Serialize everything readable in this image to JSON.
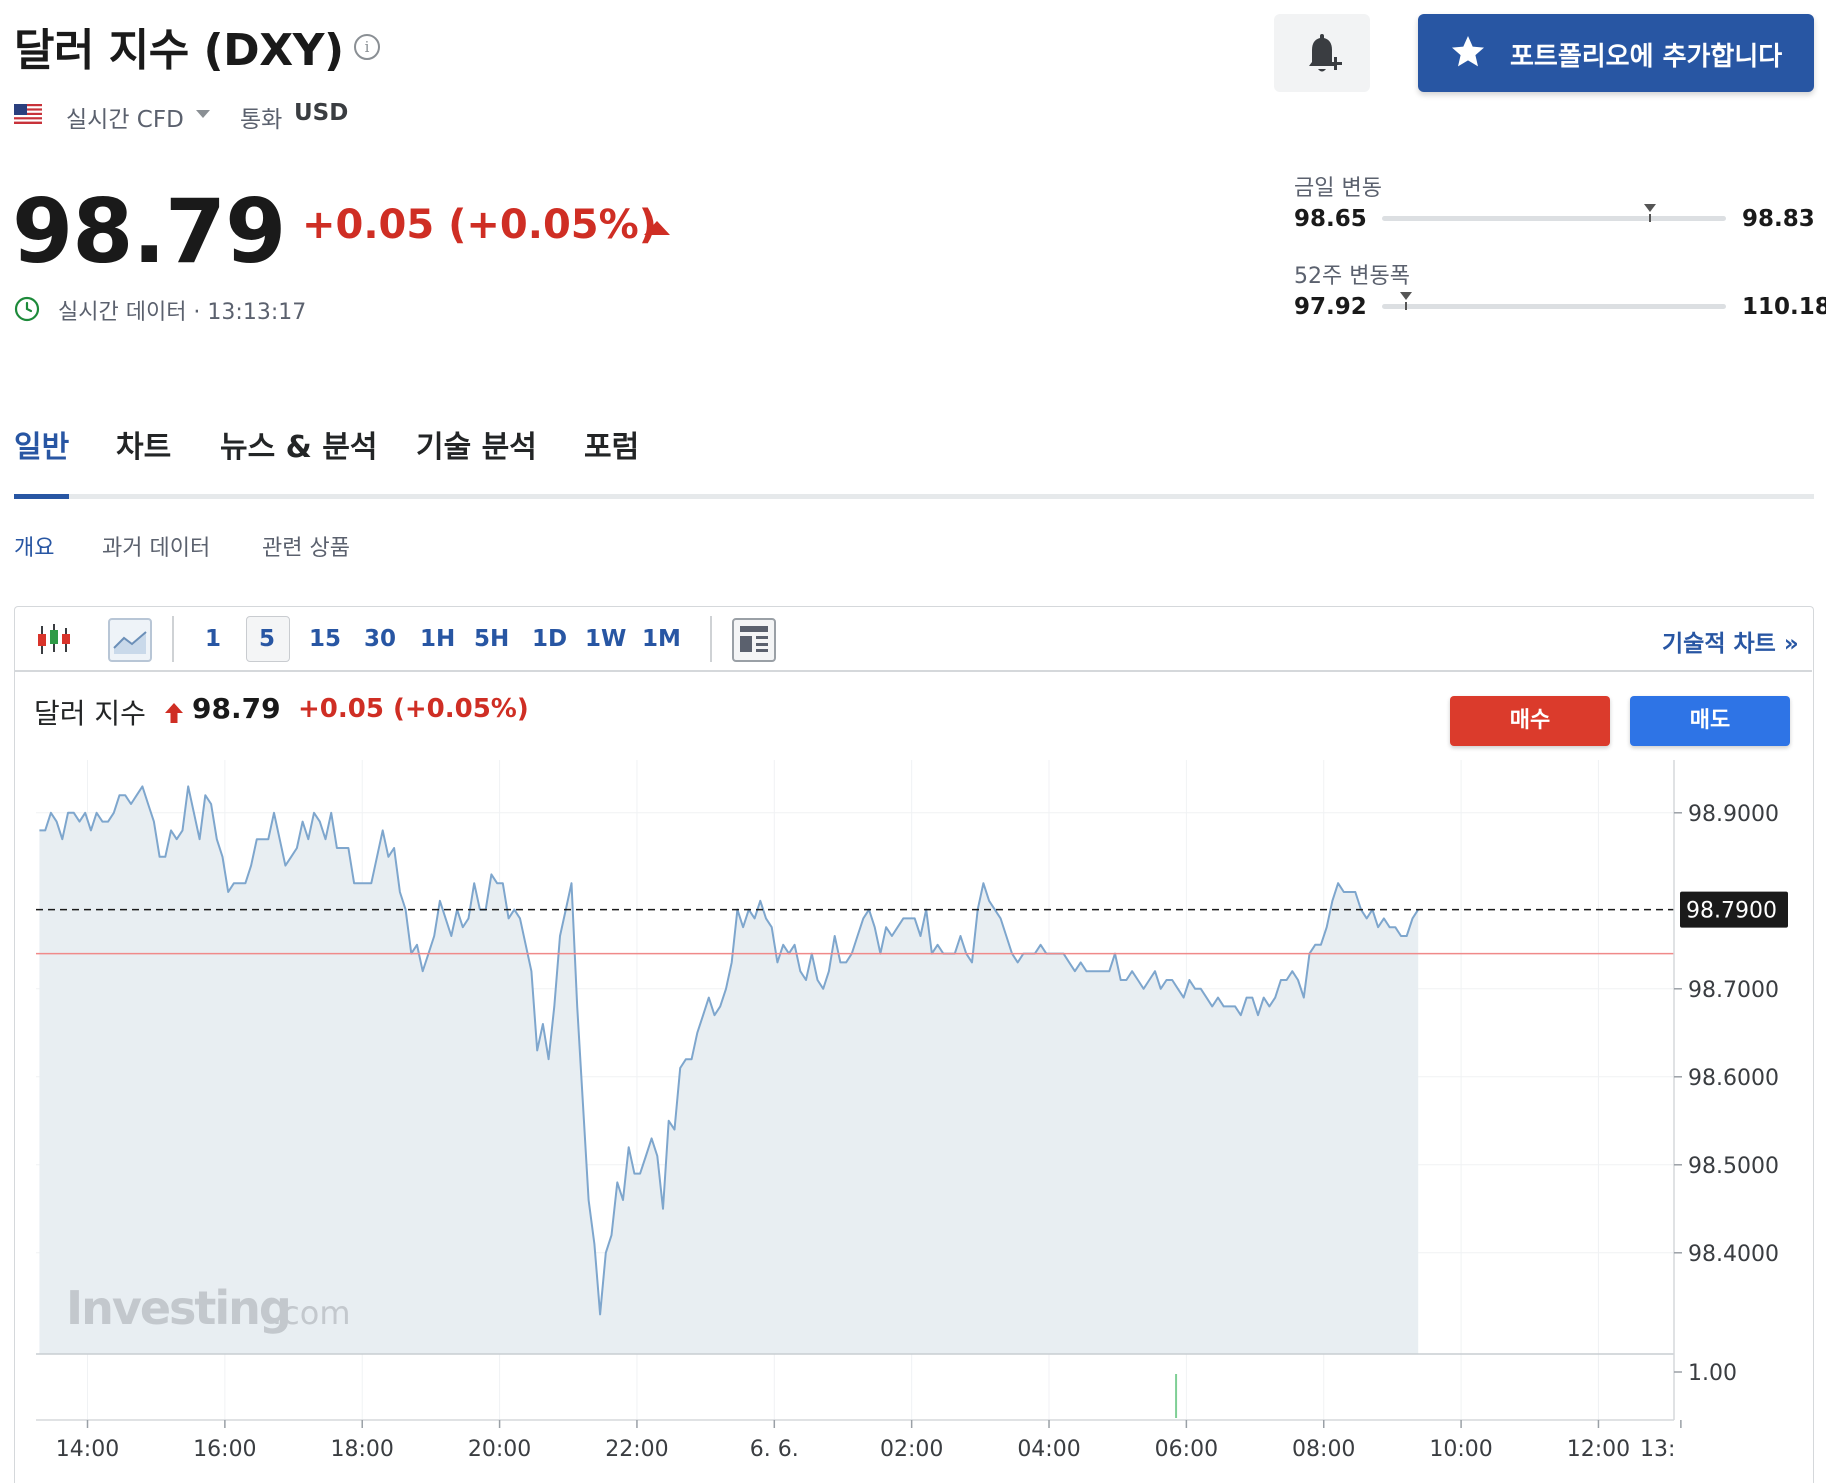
{
  "header": {
    "title": "달러 지수 (DXY)",
    "info_icon": "info-icon",
    "alert_icon": "bell-plus-icon",
    "portfolio_button": "포트폴리오에 추가합니다",
    "portfolio_icon": "star-icon",
    "market_type": "실시간 CFD",
    "currency_label": "통화",
    "currency": "USD"
  },
  "quote": {
    "price": "98.79",
    "change": "+0.05 (+0.05%)",
    "direction": "up",
    "realtime_label": "실시간 데이터 · 13:13:17"
  },
  "ranges": {
    "day": {
      "label": "금일 변동",
      "low": "98.65",
      "high": "98.83",
      "current": 98.79
    },
    "week52": {
      "label": "52주 변동폭",
      "low": "97.92",
      "high": "110.18",
      "current": 98.79
    }
  },
  "tabs": [
    {
      "label": "일반",
      "active": true
    },
    {
      "label": "차트",
      "active": false
    },
    {
      "label": "뉴스 & 분석",
      "active": false
    },
    {
      "label": "기술 분석",
      "active": false
    },
    {
      "label": "포럼",
      "active": false
    }
  ],
  "subtabs": [
    {
      "label": "개요",
      "active": true
    },
    {
      "label": "과거 데이터",
      "active": false
    },
    {
      "label": "관련 상품",
      "active": false
    }
  ],
  "toolbar": {
    "timeframes": [
      "1",
      "5",
      "15",
      "30",
      "1H",
      "5H",
      "1D",
      "1W",
      "1M"
    ],
    "selected": "5",
    "technical_chart_label": "기술적 차트 »"
  },
  "chart_header": {
    "name": "달러 지수",
    "price": "98.79",
    "change": "+0.05 (+0.05%)",
    "buy_label": "매수",
    "sell_label": "매도"
  },
  "colors": {
    "accent": "#2856a3",
    "up": "#cf2e24",
    "line": "#7ea6cd",
    "fill": "#e8eef2",
    "buy": "#db3b2c",
    "sell": "#2e74e6"
  },
  "chart_data": {
    "type": "area",
    "x_tick_labels": [
      "14:00",
      "16:00",
      "18:00",
      "20:00",
      "22:00",
      "6. 6.",
      "02:00",
      "04:00",
      "06:00",
      "08:00",
      "10:00",
      "12:00",
      "13:"
    ],
    "x_ticks_hours": [
      14,
      16,
      18,
      20,
      22,
      24,
      26,
      28,
      30,
      32,
      34,
      36,
      37.2
    ],
    "x_range_hours": [
      13.25,
      37.1
    ],
    "ylim": [
      98.285,
      98.96
    ],
    "y_ticks": [
      98.9,
      98.7,
      98.6,
      98.5,
      98.4
    ],
    "y_tick_labels": [
      "98.9000",
      "98.7000",
      "98.6000",
      "98.5000",
      "98.4000"
    ],
    "current_value": 98.79,
    "current_label": "98.7900",
    "reference_line": 98.74,
    "volume_label": "1.00",
    "volume_hour": 29.85,
    "watermark": "Investing.com",
    "series": [
      {
        "x_start": 13.3,
        "x_step": 0.0833,
        "values": [
          98.88,
          98.88,
          98.9,
          98.89,
          98.87,
          98.9,
          98.9,
          98.89,
          98.9,
          98.88,
          98.9,
          98.89,
          98.89,
          98.9,
          98.92,
          98.92,
          98.91,
          98.92,
          98.93,
          98.91,
          98.89,
          98.85,
          98.85,
          98.88,
          98.87,
          98.88,
          98.93,
          98.9,
          98.87,
          98.92,
          98.91,
          98.87,
          98.85,
          98.81,
          98.82,
          98.82,
          98.82,
          98.84,
          98.87,
          98.87,
          98.87,
          98.9,
          98.87,
          98.84,
          98.85,
          98.86,
          98.89,
          98.87,
          98.9,
          98.89,
          98.87,
          98.9,
          98.86,
          98.86,
          98.86,
          98.82,
          98.82,
          98.82,
          98.82,
          98.85,
          98.88,
          98.85,
          98.86,
          98.81,
          98.79,
          98.74,
          98.75,
          98.72,
          98.74,
          98.76,
          98.8,
          98.78,
          98.76,
          98.79,
          98.77,
          98.78,
          98.82,
          98.79,
          98.79,
          98.83,
          98.82,
          98.82,
          98.78,
          98.79,
          98.78,
          98.75,
          98.72,
          98.63,
          98.66,
          98.62,
          98.68,
          98.76,
          98.79,
          98.82,
          98.68,
          98.57,
          98.46,
          98.41,
          98.33,
          98.4,
          98.42,
          98.48,
          98.46,
          98.52,
          98.49,
          98.49,
          98.51,
          98.53,
          98.51,
          98.45,
          98.55,
          98.54,
          98.61,
          98.62,
          98.62,
          98.65,
          98.67,
          98.69,
          98.67,
          98.68,
          98.7,
          98.73,
          98.79,
          98.77,
          98.79,
          98.78,
          98.8,
          98.78,
          98.77,
          98.73,
          98.75,
          98.74,
          98.75,
          98.72,
          98.71,
          98.74,
          98.71,
          98.7,
          98.72,
          98.76,
          98.73,
          98.73,
          98.74,
          98.76,
          98.78,
          98.79,
          98.77,
          98.74,
          98.77,
          98.76,
          98.77,
          98.78,
          98.78,
          98.78,
          98.76,
          98.79,
          98.74,
          98.75,
          98.74,
          98.74,
          98.74,
          98.76,
          98.74,
          98.73,
          98.79,
          98.82,
          98.8,
          98.79,
          98.78,
          98.76,
          98.74,
          98.73,
          98.74,
          98.74,
          98.74,
          98.75,
          98.74,
          98.74,
          98.74,
          98.74,
          98.73,
          98.72,
          98.73,
          98.72,
          98.72,
          98.72,
          98.72,
          98.72,
          98.74,
          98.71,
          98.71,
          98.72,
          98.71,
          98.7,
          98.71,
          98.72,
          98.7,
          98.71,
          98.71,
          98.7,
          98.69,
          98.71,
          98.7,
          98.7,
          98.69,
          98.68,
          98.69,
          98.68,
          98.68,
          98.68,
          98.67,
          98.69,
          98.69,
          98.67,
          98.69,
          98.68,
          98.69,
          98.71,
          98.71,
          98.72,
          98.71,
          98.69,
          98.74,
          98.75,
          98.75,
          98.77,
          98.8,
          98.82,
          98.81,
          98.81,
          98.81,
          98.79,
          98.78,
          98.79,
          98.77,
          98.78,
          98.77,
          98.77,
          98.76,
          98.76,
          98.78,
          98.79
        ]
      }
    ]
  }
}
